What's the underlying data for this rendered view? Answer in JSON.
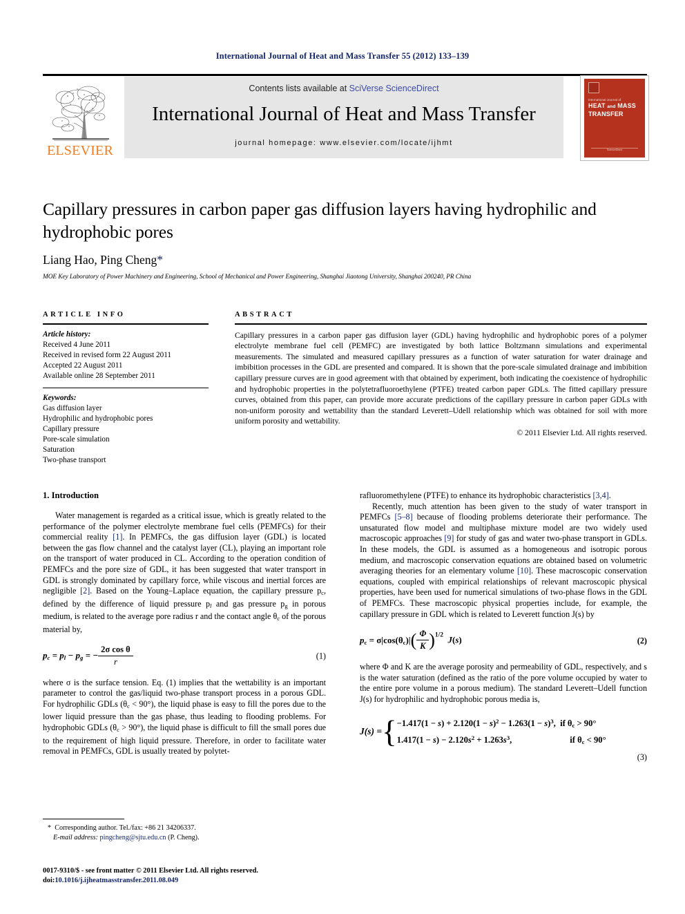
{
  "running_head": "International Journal of Heat and Mass Transfer 55 (2012) 133–139",
  "masthead": {
    "contents_prefix": "Contents lists available at ",
    "sciencedirect": "SciVerse ScienceDirect",
    "journal_title": "International Journal of Heat and Mass Transfer",
    "homepage": "journal homepage: www.elsevier.com/locate/ijhmt",
    "elsevier_wordmark": "ELSEVIER",
    "cover": {
      "small_text": "International Journal of",
      "line1": "HEAT",
      "and": "and",
      "line2": "MASS",
      "line3": "TRANSFER",
      "footer": "ScienceDirect"
    }
  },
  "title": "Capillary pressures in carbon paper gas diffusion layers having hydrophilic and hydrophobic pores",
  "authors": "Liang Hao, Ping Cheng",
  "author_star": "*",
  "affiliation": "MOE Key Laboratory of Power Machinery and Engineering, School of Mechanical and Power Engineering, Shanghai Jiaotong University, Shanghai 200240, PR China",
  "article_info": {
    "heading": "ARTICLE INFO",
    "history_label": "Article history:",
    "history": [
      "Received 4 June 2011",
      "Received in revised form 22 August 2011",
      "Accepted 22 August 2011",
      "Available online 28 September 2011"
    ],
    "keywords_label": "Keywords:",
    "keywords": [
      "Gas diffusion layer",
      "Hydrophilic and hydrophobic pores",
      "Capillary pressure",
      "Pore-scale simulation",
      "Saturation",
      "Two-phase transport"
    ]
  },
  "abstract": {
    "heading": "ABSTRACT",
    "text": "Capillary pressures in a carbon paper gas diffusion layer (GDL) having hydrophilic and hydrophobic pores of a polymer electrolyte membrane fuel cell (PEMFC) are investigated by both lattice Boltzmann simulations and experimental measurements. The simulated and measured capillary pressures as a function of water saturation for water drainage and imbibition processes in the GDL are presented and compared. It is shown that the pore-scale simulated drainage and imbibition capillary pressure curves are in good agreement with that obtained by experiment, both indicating the coexistence of hydrophilic and hydrophobic properties in the polytetrafluoroethylene (PTFE) treated carbon paper GDLs. The fitted capillary pressure curves, obtained from this paper, can provide more accurate predictions of the capillary pressure in carbon paper GDLs with non-uniform porosity and wettability than the standard Leverett–Udell relationship which was obtained for soil with more uniform porosity and wettability.",
    "copyright": "© 2011 Elsevier Ltd. All rights reserved."
  },
  "body": {
    "section_heading": "1. Introduction",
    "left_p1_a": "Water management is regarded as a critical issue, which is greatly related to the performance of the polymer electrolyte membrane fuel cells (PEMFCs) for their commercial reality ",
    "left_p1_ref1": "[1]",
    "left_p1_b": ". In PEMFCs, the gas diffusion layer (GDL) is located between the gas flow channel and the catalyst layer (CL), playing an important role on the transport of water produced in CL. According to the operation condition of PEMFCs and the pore size of GDL, it has been suggested that water transport in GDL is strongly dominated by capillary force, while viscous and inertial forces are negligible ",
    "left_p1_ref2": "[2]",
    "left_p1_c": ". Based on the Young–Laplace equation, the capillary pressure p",
    "left_p1_d": ", defined by the difference of liquid pressure p",
    "left_p1_e": " and gas pressure p",
    "left_p1_f": " in porous medium, is related to the average pore radius r and the contact angle θ",
    "left_p1_g": " of the porous material by,",
    "eq1_number": "(1)",
    "eq1_lhs": "p",
    "eq1_num": "2σ cos θ",
    "eq1_den": "r",
    "left_p2_a": "where σ is the surface tension. Eq. (1) implies that the wettability is an important parameter to control the gas/liquid two-phase transport process in a porous GDL. For hydrophilic GDLs (θ",
    "left_p2_b": " < 90°), the liquid phase is easy to fill the pores due to the lower liquid pressure than the gas phase, thus leading to flooding problems. For hydrophobic GDLs (θ",
    "left_p2_c": " > 90°), the liquid phase is difficult to fill the small pores due to the requirement of high liquid pressure. Therefore, in order to facilitate water removal in PEMFCs, GDL is usually treated by polytet-",
    "right_p0_a": "rafluoromethylene (PTFE) to enhance its hydrophobic characteristics ",
    "right_p0_ref": "[3,4]",
    "right_p0_b": ".",
    "right_p1_a": "Recently, much attention has been given to the study of water transport in PEMFCs ",
    "right_p1_ref1": "[5–8]",
    "right_p1_b": " because of flooding problems deteriorate their performance. The unsaturated flow model and multiphase mixture model are two widely used macroscopic approaches ",
    "right_p1_ref2": "[9]",
    "right_p1_c": " for study of gas and water two-phase transport in GDLs. In these models, the GDL is assumed as a homogeneous and isotropic porous medium, and macroscopic conservation equations are obtained based on volumetric averaging theories for an elementary volume ",
    "right_p1_ref3": "[10]",
    "right_p1_d": ". These macroscopic conservation equations, coupled with empirical relationships of relevant macroscopic physical properties, have been used for numerical simulations of two-phase flows in the GDL of PEMFCs. These macroscopic physical properties include, for example, the capillary pressure in GDL which is related to Leverett function J(s) by",
    "eq2_number": "(2)",
    "eq2_text": "pc = σ|cos(θc)| (Φ/K)^1/2 J(s)",
    "right_p2": "where Φ and K are the average porosity and permeability of GDL, respectively, and s is the water saturation (defined as the ratio of the pore volume occupied by water to the entire pore volume in a porous medium). The standard Leverett–Udell function J(s) for hydrophilic and hydrophobic porous media is,",
    "eq3_number": "(3)",
    "eq3_row1": "−1.417(1 − s) + 2.120(1 − s)2 − 1.263(1 − s)3,",
    "eq3_row1_cond": "if θc > 90°",
    "eq3_row2": "1.417(1 − s) − 2.120s2 + 1.263s3,",
    "eq3_row2_cond": "if θc < 90°"
  },
  "footnotes": {
    "corresponding": "Corresponding author. Tel./fax: +86 21 34206337.",
    "email_label": "E-mail address:",
    "email": "pingcheng@sjtu.edu.cn",
    "email_suffix": " (P. Cheng).",
    "issn_line": "0017-9310/$ - see front matter © 2011 Elsevier Ltd. All rights reserved.",
    "doi_label": "doi:",
    "doi": "10.1016/j.ijheatmasstransfer.2011.08.049"
  }
}
